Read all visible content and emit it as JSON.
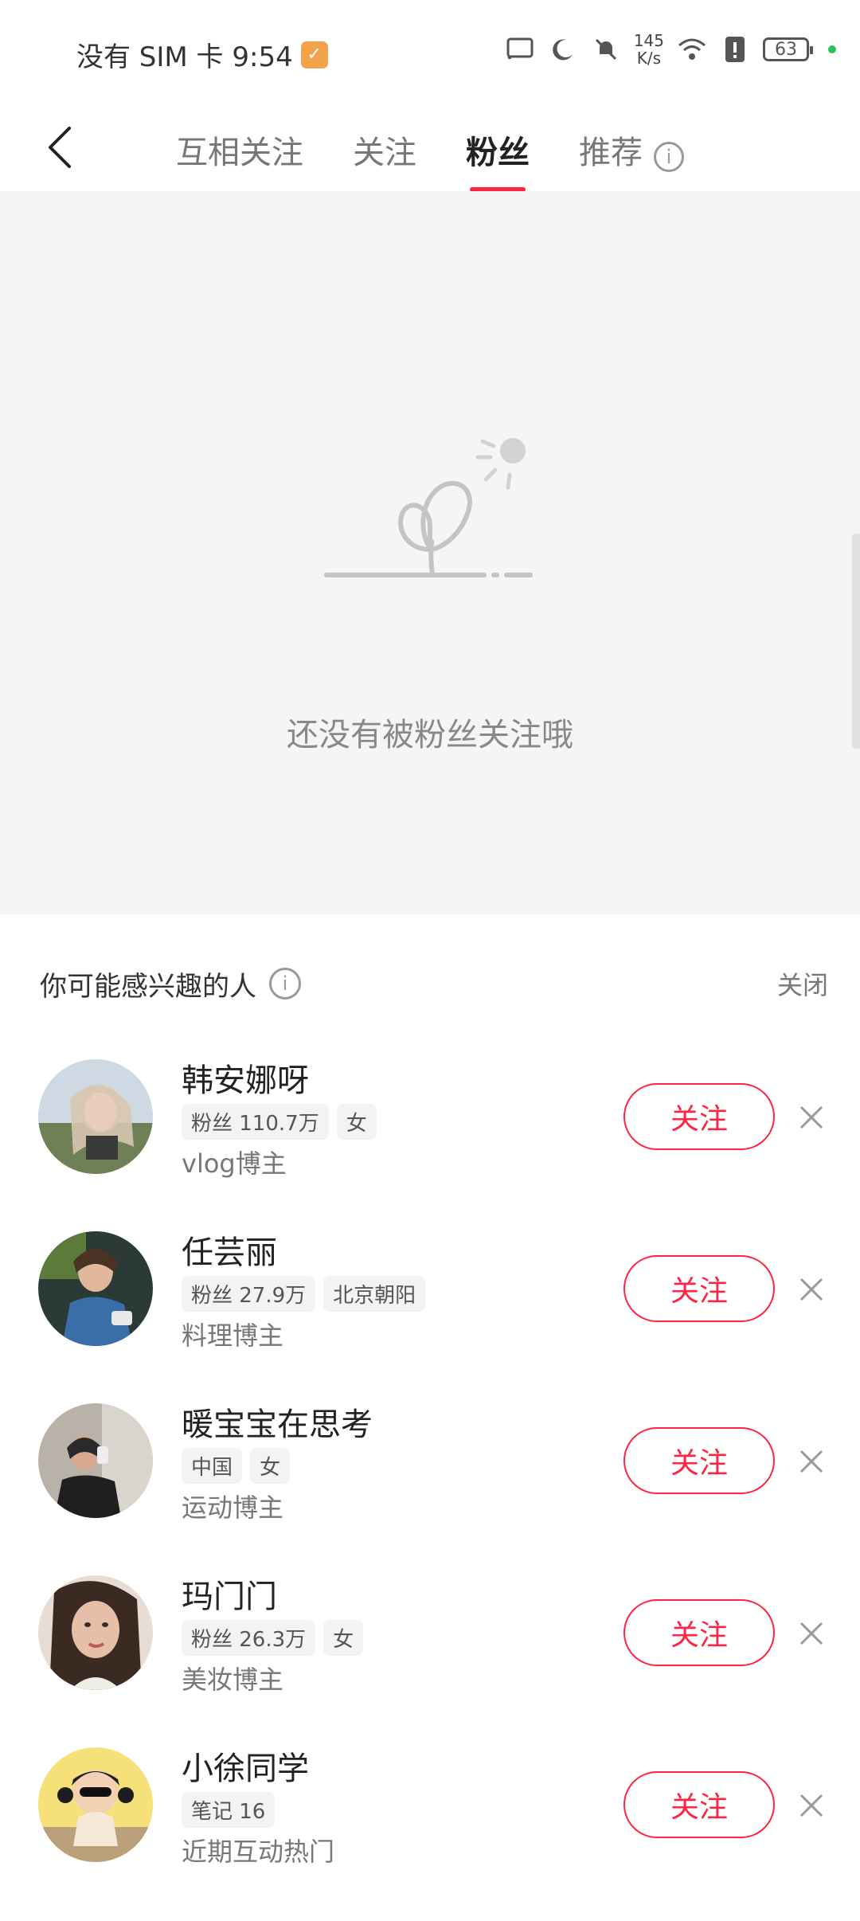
{
  "status_bar": {
    "left_text": "没有 SIM 卡 9:54",
    "net_speed_value": "145",
    "net_speed_unit": "K/s",
    "battery": "63"
  },
  "header": {
    "tabs": [
      {
        "label": "互相关注"
      },
      {
        "label": "关注"
      },
      {
        "label": "粉丝"
      },
      {
        "label": "推荐"
      }
    ],
    "active_tab": "粉丝"
  },
  "empty_state": {
    "message": "还没有被粉丝关注哦"
  },
  "suggestions": {
    "title": "你可能感兴趣的人",
    "close_label": "关闭",
    "follow_label": "关注",
    "people": [
      {
        "name": "韩安娜呀",
        "tags": [
          "粉丝 110.7万",
          "女"
        ],
        "desc": "vlog博主"
      },
      {
        "name": "任芸丽",
        "tags": [
          "粉丝 27.9万",
          "北京朝阳"
        ],
        "desc": "料理博主"
      },
      {
        "name": "暖宝宝在思考",
        "tags": [
          "中国",
          "女"
        ],
        "desc": "运动博主"
      },
      {
        "name": "玛门门",
        "tags": [
          "粉丝 26.3万",
          "女"
        ],
        "desc": "美妆博主"
      },
      {
        "name": "小徐同学",
        "tags": [
          "笔记 16"
        ],
        "desc": "近期互动热门"
      }
    ]
  },
  "colors": {
    "accent": "#ff2442",
    "empty_bg": "#f5f5f5"
  }
}
